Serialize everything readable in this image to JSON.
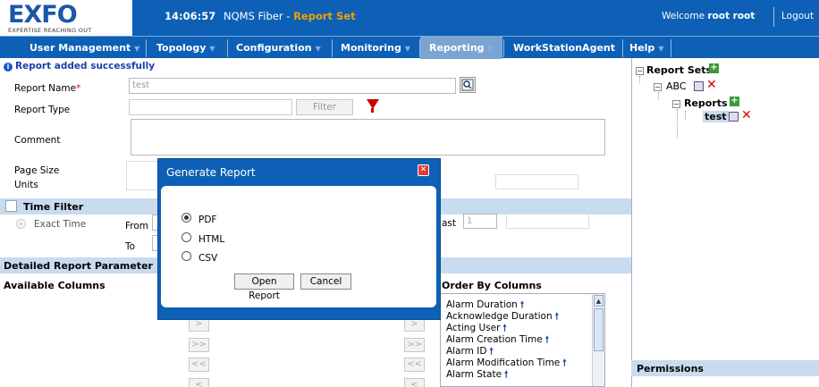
{
  "header": {
    "logo": "EXFO",
    "logo_tagline": "EXPERTISE REACHING OUT",
    "time": "14:06:57",
    "app": "NQMS Fiber",
    "separator": " - ",
    "page": "Report Set",
    "welcome": "Welcome ",
    "user": "root root",
    "logout": "Logout"
  },
  "menu": {
    "items": [
      {
        "label": "User Management"
      },
      {
        "label": "Topology"
      },
      {
        "label": "Configuration"
      },
      {
        "label": "Monitoring"
      },
      {
        "label": "Reporting"
      },
      {
        "label": "WorkStationAgent"
      },
      {
        "label": "Help"
      }
    ],
    "active": "Reporting"
  },
  "status": "Report added successfully",
  "form": {
    "report_name_label": "Report Name",
    "required_mark": "*",
    "report_name_value": "test",
    "report_type_label": "Report Type",
    "filter_button": "Filter",
    "comment_label": "Comment",
    "page_size_label": "Page Size",
    "units_label": "Units",
    "time_filter_title": "Time Filter",
    "exact_time_label": "Exact Time",
    "from_label": "From",
    "to_label": "To",
    "last_label": "ast",
    "last_value": "1",
    "detailed_title": "Detailed Report Parameter",
    "available_columns": "Available Columns",
    "order_by_columns": "Order By Columns",
    "move_right": ">>",
    "move_left": "<<"
  },
  "order_by_list": [
    "Alarm Duration",
    "Acknowledge Duration",
    "Acting User",
    "Alarm Creation Time",
    "Alarm ID",
    "Alarm Modification Time",
    "Alarm State"
  ],
  "tree": {
    "root": "Report Sets",
    "set": "ABC",
    "reports": "Reports",
    "report": "test"
  },
  "permissions_title": "Permissions",
  "dialog": {
    "title": "Generate Report",
    "options": [
      "PDF",
      "HTML",
      "CSV"
    ],
    "selected": "PDF",
    "open_button": "Open Report",
    "cancel_button": "Cancel"
  }
}
